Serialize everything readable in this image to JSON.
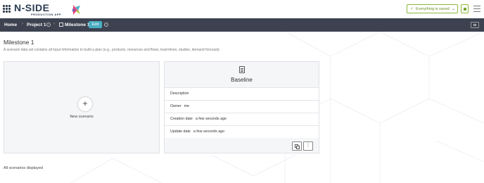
{
  "header": {
    "logo_main": "N-SIDE",
    "logo_sub": "PRODUCTION APP",
    "save_status": "Everything is saved",
    "icons": [
      "apps-grid-icon",
      "check-icon",
      "chevron-down-icon",
      "hamburger-menu-icon"
    ]
  },
  "breadcrumb": {
    "home": "Home",
    "project": "Project 1",
    "milestone": "Milestone 1",
    "edit_label": "Edit"
  },
  "page": {
    "title": "Milestone 1",
    "description": "A scenario data set contains all input information to build a plan (e.g., products, resources and flows, lead-times, studies, demand forecast)."
  },
  "new_scenario": {
    "label": "New scenario"
  },
  "scenario_card": {
    "title": "Baseline",
    "rows": [
      {
        "label": "Description",
        "value": ""
      },
      {
        "label": "Owner",
        "value": "me"
      },
      {
        "label": "Creation date",
        "value": "a few seconds ago"
      },
      {
        "label": "Update date",
        "value": "a few seconds ago"
      }
    ]
  },
  "footer": {
    "status": "All scenarios displayed"
  },
  "colors": {
    "breadcrumb_bg": "#3c4250",
    "accent_edit": "#4aaec3",
    "saved_green": "#8bb73a",
    "card_bg": "#f5f6f8"
  }
}
